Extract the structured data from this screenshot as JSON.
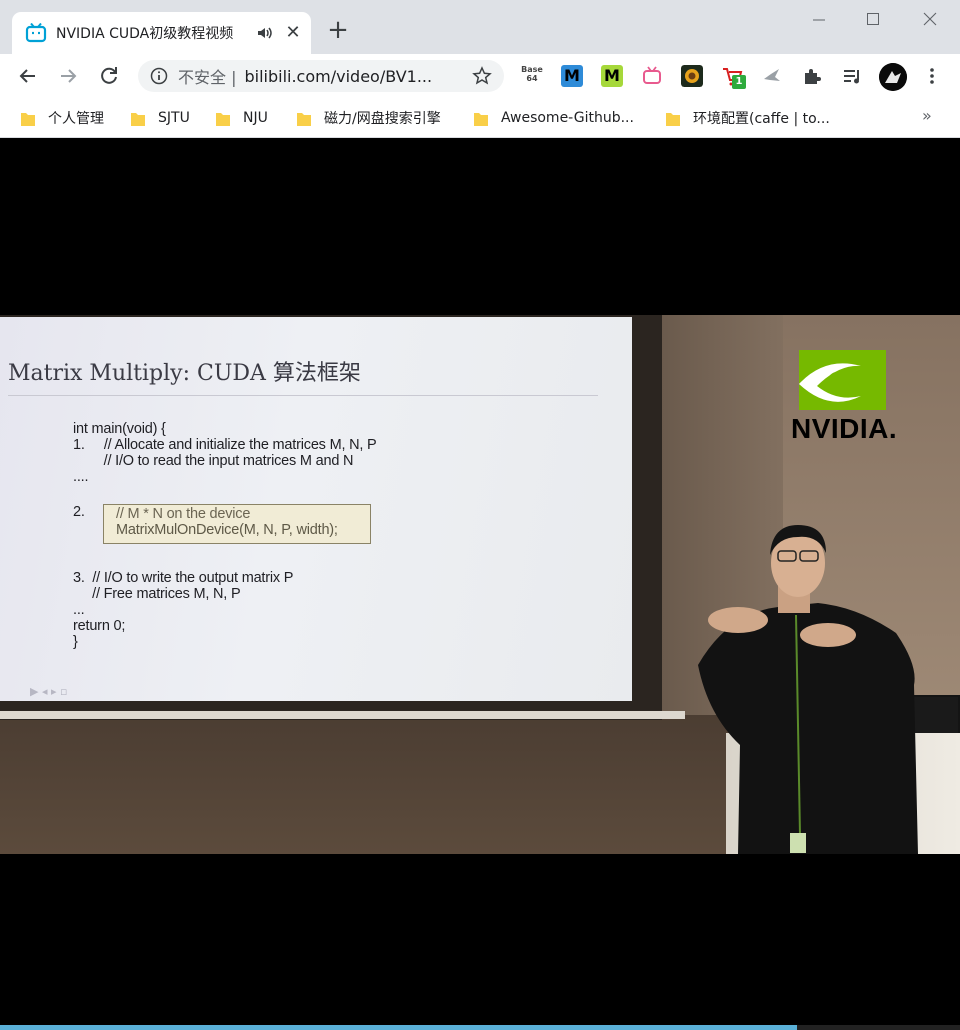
{
  "browser": {
    "tab": {
      "title": "NVIDIA CUDA初级教程视频",
      "favicon": "bilibili-tv-icon",
      "audio_icon": "speaker-icon",
      "close_label": "✕"
    },
    "new_tab_label": "+",
    "window_controls": {
      "minimize": "—",
      "maximize": "☐",
      "close": "✕"
    },
    "address": {
      "security_label": "不安全 |",
      "url": "bilibili.com/video/BV1..."
    },
    "extensions": [
      {
        "name": "base64-extension",
        "label": "Base 64"
      },
      {
        "name": "m-blue-extension",
        "label": "M"
      },
      {
        "name": "m-green-extension",
        "label": "M"
      },
      {
        "name": "tv-extension",
        "label": ""
      },
      {
        "name": "sunflower-extension",
        "label": ""
      },
      {
        "name": "cart-extension",
        "label": "",
        "badge": "1"
      },
      {
        "name": "bird-extension",
        "label": ""
      },
      {
        "name": "puzzle-extension",
        "label": ""
      },
      {
        "name": "media-extension",
        "label": ""
      }
    ],
    "bookmarks": [
      "个人管理",
      "SJTU",
      "NJU",
      "磁力/网盘搜索引擎",
      "Awesome-Github...",
      "环境配置(caffe | to..."
    ],
    "bookmarks_more": "»"
  },
  "video": {
    "slide": {
      "title": "Matrix Multiply:  CUDA 算法框架",
      "lines": [
        "int main(void) {",
        "1.     // Allocate and initialize the matrices M, N, P",
        "        // I/O to read the input matrices M and N",
        "....",
        "2.",
        "3.  // I/O to write the output matrix P",
        "     // Free matrices M, N, P",
        "...",
        "return 0;",
        "}"
      ],
      "highlight": [
        "// M * N on the device",
        "MatrixMulOnDevice(M, N, P, width);"
      ]
    },
    "logo_text": "NVIDIA.",
    "progress": 0.83,
    "colors": {
      "nvidia_green": "#76b900",
      "progress": "#5ab0d7"
    }
  }
}
